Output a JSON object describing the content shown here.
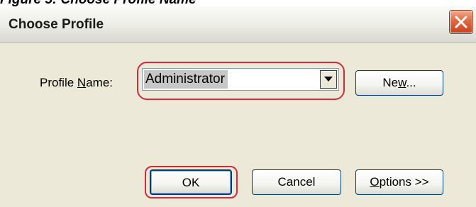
{
  "caption": "Figure 5: Choose Profile Name",
  "dialog": {
    "title": "Choose Profile",
    "close_icon": "close-icon"
  },
  "profile": {
    "label_prefix": "Profile ",
    "label_mnemonic": "N",
    "label_suffix": "ame:",
    "selected_value": "Administrator",
    "dropdown_icon": "chevron-down-icon"
  },
  "buttons": {
    "new_prefix": "Ne",
    "new_mnemonic": "w",
    "new_suffix": "...",
    "ok": "OK",
    "cancel": "Cancel",
    "options_mnemonic": "O",
    "options_suffix": "ptions >>"
  },
  "colors": {
    "highlight": "#d42a3a",
    "dialog_bg": "#ece9d8",
    "close_button": "#e2673f"
  }
}
